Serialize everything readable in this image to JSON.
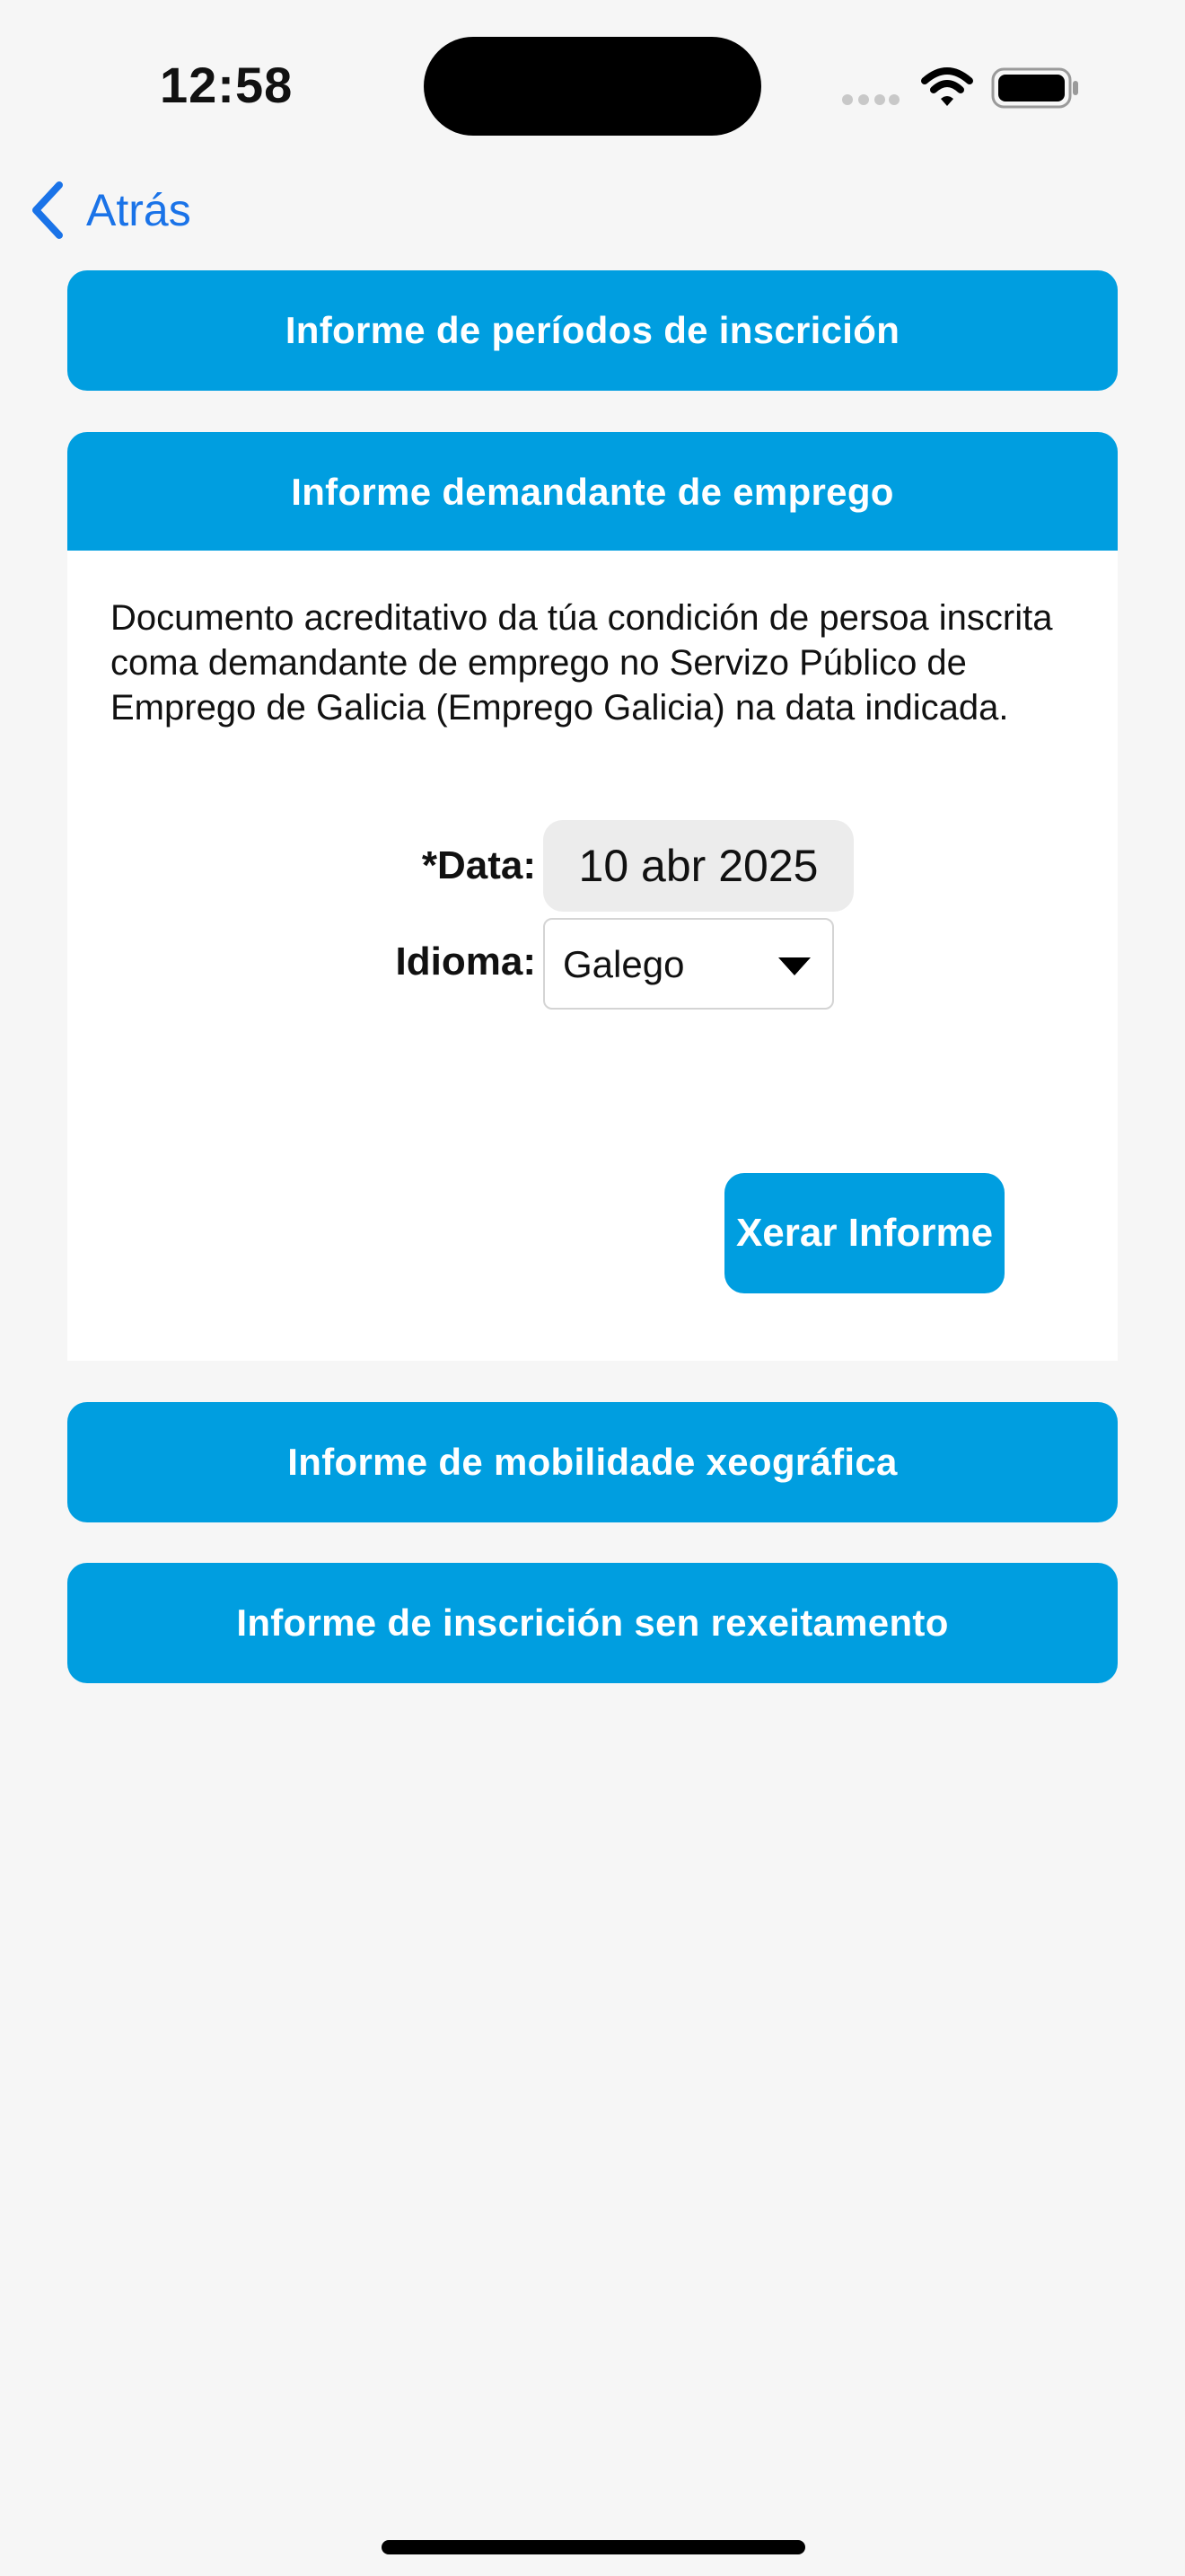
{
  "status_bar": {
    "time": "12:58",
    "icons": [
      "signal-dots-icon",
      "wifi-icon",
      "battery-icon"
    ]
  },
  "nav": {
    "back_label": "Atrás",
    "back_icon": "chevron-left-icon",
    "accent_color": "#1a73e8"
  },
  "sections": [
    {
      "label": "Informe de períodos de inscrición",
      "expanded": false
    },
    {
      "label": "Informe demandante de emprego",
      "expanded": true
    },
    {
      "label": "Informe de mobilidade xeográfica",
      "expanded": false
    },
    {
      "label": "Informe de inscrición sen rexeitamento",
      "expanded": false
    }
  ],
  "report_form": {
    "description": "Documento acreditativo da túa condición de persoa inscrita coma demandante de emprego no Servizo Público de Emprego de Galicia (Emprego Galicia) na data indicada.",
    "date_label": "*Data:",
    "date_value": "10 abr 2025",
    "language_label": "Idioma:",
    "language_value": "Galego",
    "generate_label": "Xerar Informe"
  },
  "colors": {
    "primary_button": "#009ee0",
    "background": "#f6f6f6",
    "panel": "#ffffff"
  }
}
